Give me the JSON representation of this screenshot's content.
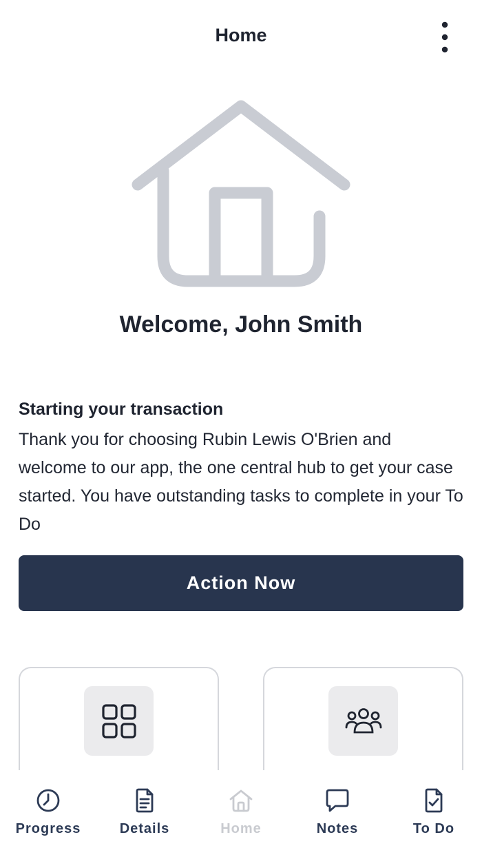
{
  "header": {
    "title": "Home",
    "menu_icon": "more-vertical-icon"
  },
  "hero": {
    "icon": "house-icon",
    "color": "#c9ccd3"
  },
  "welcome": {
    "text": "Welcome, John Smith"
  },
  "intro": {
    "heading": "Starting your transaction",
    "body": "Thank you for choosing Rubin Lewis O'Brien and welcome to our app, the one central hub to get your case started. You have outstanding tasks to complete in your To Do"
  },
  "action": {
    "label": "Action Now",
    "color": "#28354e"
  },
  "cards": [
    {
      "icon": "grid-icon"
    },
    {
      "icon": "people-icon"
    }
  ],
  "tabbar": {
    "active_color": "#2c3a55",
    "inactive_color": "#c9cbd0",
    "tabs": [
      {
        "label": "Progress",
        "icon": "clock-icon",
        "active": false
      },
      {
        "label": "Details",
        "icon": "document-icon",
        "active": false
      },
      {
        "label": "Home",
        "icon": "home-icon",
        "active": true
      },
      {
        "label": "Notes",
        "icon": "chat-bubble-icon",
        "active": false
      },
      {
        "label": "To Do",
        "icon": "checklist-document-icon",
        "active": false
      }
    ]
  }
}
